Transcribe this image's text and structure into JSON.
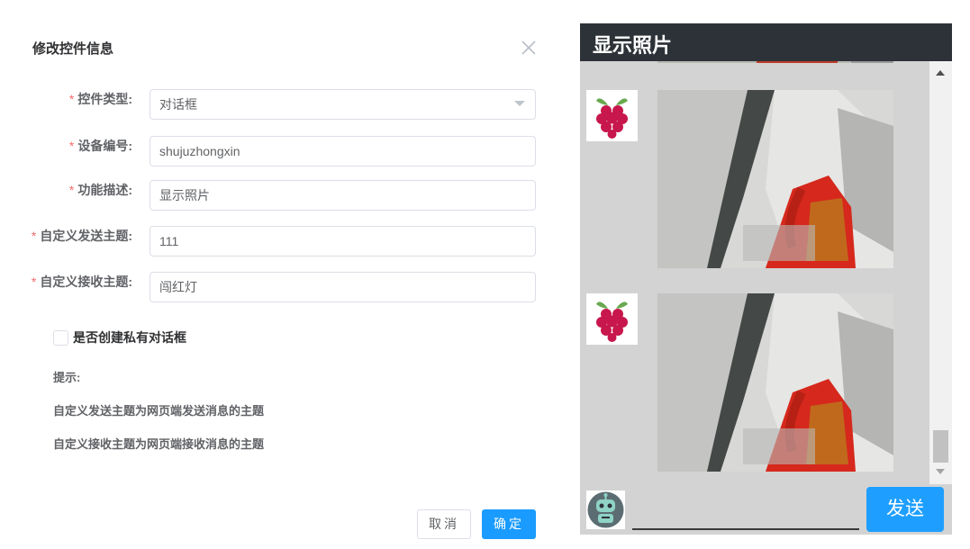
{
  "dialog": {
    "title": "修改控件信息",
    "fields": [
      {
        "label": "控件类型:",
        "value": "对话框",
        "type": "select"
      },
      {
        "label": "设备编号:",
        "value": "shujuzhongxin",
        "type": "input"
      },
      {
        "label": "功能描述:",
        "value": "显示照片",
        "type": "input"
      },
      {
        "label": "自定义发送主题:",
        "value": "111",
        "type": "input"
      },
      {
        "label": "自定义接收主题:",
        "value": "闯红灯",
        "type": "input"
      }
    ],
    "required_mark": "*",
    "checkbox_label": "是否创建私有对话框",
    "checkbox_checked": false,
    "tip_title": "提示:",
    "tips": [
      "自定义发送主题为网页端发送消息的主题",
      "自定义接收主题为网页端接收消息的主题"
    ],
    "cancel_label": "取消",
    "ok_label": "确定"
  },
  "chat": {
    "title": "显示照片",
    "input_value": "",
    "send_label": "发送"
  },
  "colors": {
    "primary": "#1a9bff",
    "required": "#f56c6c",
    "chat_header": "#2d3238",
    "chat_bg": "#d3d3d3",
    "send_button": "#1e9fff"
  }
}
